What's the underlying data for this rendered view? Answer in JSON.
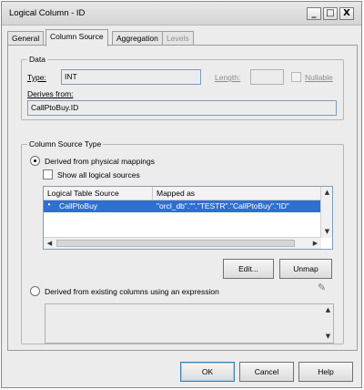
{
  "window": {
    "title": "Logical Column - ID",
    "minimize_glyph": "_",
    "maximize_glyph": "□",
    "close_glyph": "X"
  },
  "tabs": [
    {
      "label": "General"
    },
    {
      "label": "Column Source"
    },
    {
      "label": "Aggregation"
    },
    {
      "label": "Levels"
    }
  ],
  "data_group": {
    "legend": "Data",
    "type_label": "Type:",
    "type_value": "INT",
    "length_label": "Length:",
    "length_value": "",
    "nullable_label": "Nullable",
    "nullable_checked": false,
    "derives_label": "Derives from:",
    "derives_value": "CallPtoBuy.ID"
  },
  "source_group": {
    "legend": "Column Source Type",
    "physical_label": "Derived from physical mappings",
    "physical_selected": true,
    "show_all_label": "Show all logical sources",
    "show_all_checked": false,
    "table": {
      "columns": [
        "Logical Table Source",
        "Mapped as"
      ],
      "rows": [
        {
          "source": "CallPtoBuy",
          "mapped": "\"orcl_db\".\"\".\"TESTR\".\"CallPtoBuy\".\"ID\""
        }
      ]
    },
    "edit_label": "Edit...",
    "unmap_label": "Unmap",
    "expression_label": "Derived from existing columns using an expression",
    "expression_selected": false,
    "expression_value": ""
  },
  "footer": {
    "ok_label": "OK",
    "cancel_label": "Cancel",
    "help_label": "Help"
  },
  "colors": {
    "selection": "#2f6fd0",
    "dialog_bg": "#ececec"
  }
}
